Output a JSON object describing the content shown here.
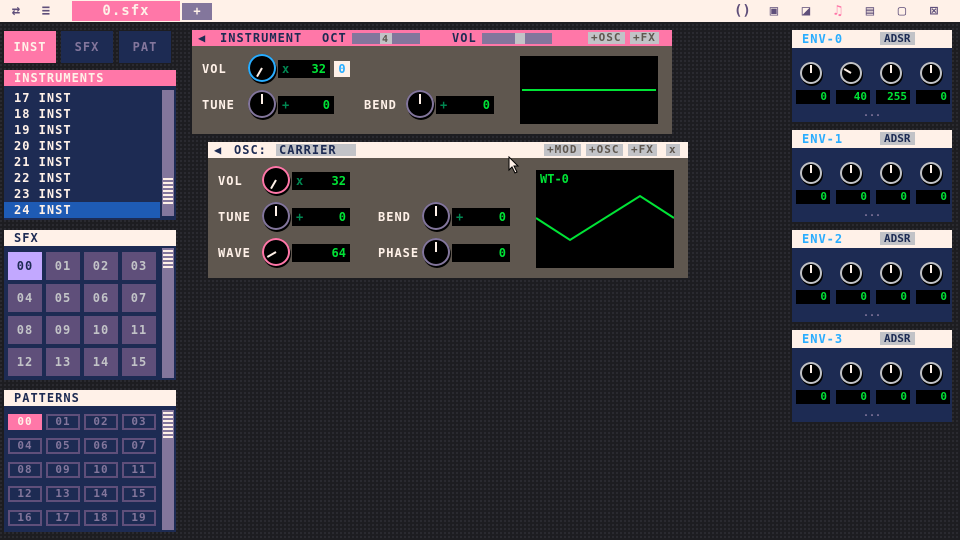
{
  "topbar": {
    "file_tab": "0.sfx",
    "add_tab": "+",
    "icons_left": [
      "swap-icon",
      "menu-icon"
    ],
    "icons_right": [
      "code-icon",
      "sprite-icon",
      "map-icon",
      "music-icon",
      "pattern-icon",
      "cart-icon",
      "export-icon"
    ]
  },
  "side_tabs": [
    "INST",
    "SFX",
    "PAT"
  ],
  "instruments": {
    "title": "INSTRUMENTS",
    "items": [
      "17 INST",
      "18 INST",
      "19 INST",
      "20 INST",
      "21 INST",
      "22 INST",
      "23 INST",
      "24 INST"
    ],
    "selected": "24 INST"
  },
  "sfx": {
    "title": "SFX",
    "cells": [
      "00",
      "01",
      "02",
      "03",
      "04",
      "05",
      "06",
      "07",
      "08",
      "09",
      "10",
      "11",
      "12",
      "13",
      "14",
      "15"
    ],
    "selected": "00"
  },
  "patterns": {
    "title": "PATTERNS",
    "cells": [
      "00",
      "01",
      "02",
      "03",
      "04",
      "05",
      "06",
      "07",
      "08",
      "09",
      "10",
      "11",
      "12",
      "13",
      "14",
      "15",
      "16",
      "17",
      "18",
      "19"
    ],
    "selected": "00"
  },
  "instrument_module": {
    "title": "INSTRUMENT",
    "oct_label": "OCT",
    "oct_value": "4",
    "vol_label": "VOL",
    "vol_level": 0.55,
    "btn_osc": "+OSC",
    "btn_fx": "+FX",
    "vol": {
      "label": "VOL",
      "op": "x",
      "value": "32",
      "tag": "0"
    },
    "tune": {
      "label": "TUNE",
      "op": "+",
      "value": "0"
    },
    "bend": {
      "label": "BEND",
      "op": "+",
      "value": "0"
    }
  },
  "osc_module": {
    "title": "OSC:",
    "name": "CARRIER",
    "btn_mod": "+MOD",
    "btn_osc": "+OSC",
    "btn_fx": "+FX",
    "btn_close": "x",
    "vol": {
      "label": "VOL",
      "op": "x",
      "value": "32"
    },
    "tune": {
      "label": "TUNE",
      "op": "+",
      "value": "0"
    },
    "bend": {
      "label": "BEND",
      "op": "+",
      "value": "0"
    },
    "wave": {
      "label": "WAVE",
      "value": "64"
    },
    "phase": {
      "label": "PHASE",
      "value": "0"
    },
    "wavetable_label": "WT-0"
  },
  "envelopes": [
    {
      "title": "ENV-0",
      "mode": "ADSR",
      "values": [
        "0",
        "40",
        "255",
        "0"
      ],
      "more": "..."
    },
    {
      "title": "ENV-1",
      "mode": "ADSR",
      "values": [
        "0",
        "0",
        "0",
        "0"
      ],
      "more": "..."
    },
    {
      "title": "ENV-2",
      "mode": "ADSR",
      "values": [
        "0",
        "0",
        "0",
        "0"
      ],
      "more": "..."
    },
    {
      "title": "ENV-3",
      "mode": "ADSR",
      "values": [
        "0",
        "0",
        "0",
        "0"
      ],
      "more": "..."
    }
  ],
  "colors": {
    "accent_pink": "#ff77a8",
    "cream": "#fff1e8",
    "navy": "#1d2b53",
    "value_green": "#00e436",
    "module_gray": "#5f574f"
  }
}
